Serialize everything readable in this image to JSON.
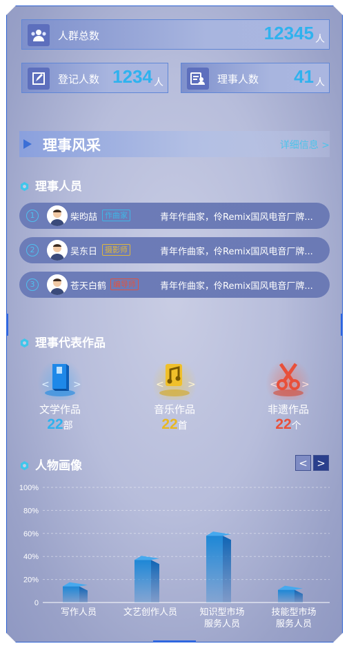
{
  "stats": {
    "total": {
      "label": "人群总数",
      "value": "12345",
      "unit": "人",
      "icon": "people-group-icon"
    },
    "registered": {
      "label": "登记人数",
      "value": "1234",
      "unit": "人",
      "icon": "edit-icon"
    },
    "directors": {
      "label": "理事人数",
      "value": "41",
      "unit": "人",
      "icon": "id-card-icon"
    }
  },
  "banner": {
    "title": "理事风采",
    "more": "详细信息 >"
  },
  "members_section": {
    "title": "理事人员"
  },
  "members": [
    {
      "index": "1",
      "name": "柴昀喆",
      "tag": "作曲家",
      "tag_color": "#3fb6e6",
      "desc": "青年作曲家，伶Remix国风电音厂牌..."
    },
    {
      "index": "2",
      "name": "吴东日",
      "tag": "摄影师",
      "tag_color": "#e0b73a",
      "desc": "青年作曲家，伶Remix国风电音厂牌..."
    },
    {
      "index": "3",
      "name": "苍天白鹤",
      "tag": "编导师",
      "tag_color": "#e2533e",
      "desc": "青年作曲家，伶Remix国风电音厂牌..."
    }
  ],
  "works_section": {
    "title": "理事代表作品"
  },
  "works": [
    {
      "label": "文学作品",
      "value": "22",
      "unit": "部",
      "color": "#2fb2ee",
      "icon": "book-icon"
    },
    {
      "label": "音乐作品",
      "value": "22",
      "unit": "首",
      "color": "#e8b824",
      "icon": "music-note-icon"
    },
    {
      "label": "非遗作品",
      "value": "22",
      "unit": "个",
      "color": "#e8503a",
      "icon": "scissors-icon"
    }
  ],
  "portrait_section": {
    "title": "人物画像",
    "prev": "<",
    "next": ">"
  },
  "chart_data": {
    "type": "bar",
    "categories": [
      "写作人员",
      "文艺创作人员",
      "知识型市场服务人员",
      "技能型市场服务人员"
    ],
    "category_lines": [
      [
        "写作人员"
      ],
      [
        "文艺创作人员"
      ],
      [
        "知识型市场",
        "服务人员"
      ],
      [
        "技能型市场",
        "服务人员"
      ]
    ],
    "values": [
      14,
      37,
      58,
      11
    ],
    "ylim": [
      0,
      100
    ],
    "yticks": [
      "0",
      "20%",
      "40%",
      "60%",
      "80%",
      "100%"
    ],
    "grid": true
  }
}
